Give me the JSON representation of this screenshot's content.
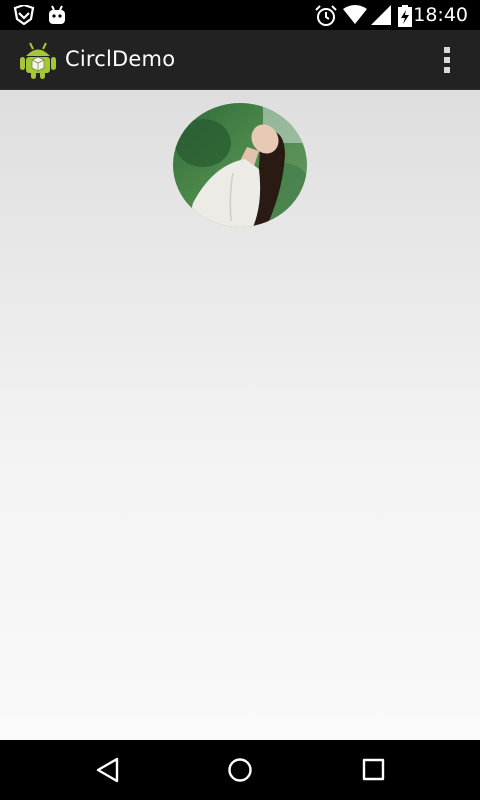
{
  "status_bar": {
    "time": "18:40",
    "icons": [
      "vpn-shield-icon",
      "android-robot-icon",
      "alarm-icon",
      "wifi-icon",
      "cellular-signal-icon",
      "battery-charging-icon"
    ]
  },
  "action_bar": {
    "app_title": "CirclDemo",
    "app_icon": "android-app-icon",
    "overflow_icon": "overflow-menu-icon"
  },
  "content": {
    "avatar_image": "circular-profile-photo"
  },
  "navigation_bar": {
    "buttons": [
      "back-icon",
      "home-icon",
      "recents-icon"
    ]
  },
  "colors": {
    "action_bar": "#222222",
    "status_bar": "#000000",
    "content_background": "#eeeeee"
  }
}
